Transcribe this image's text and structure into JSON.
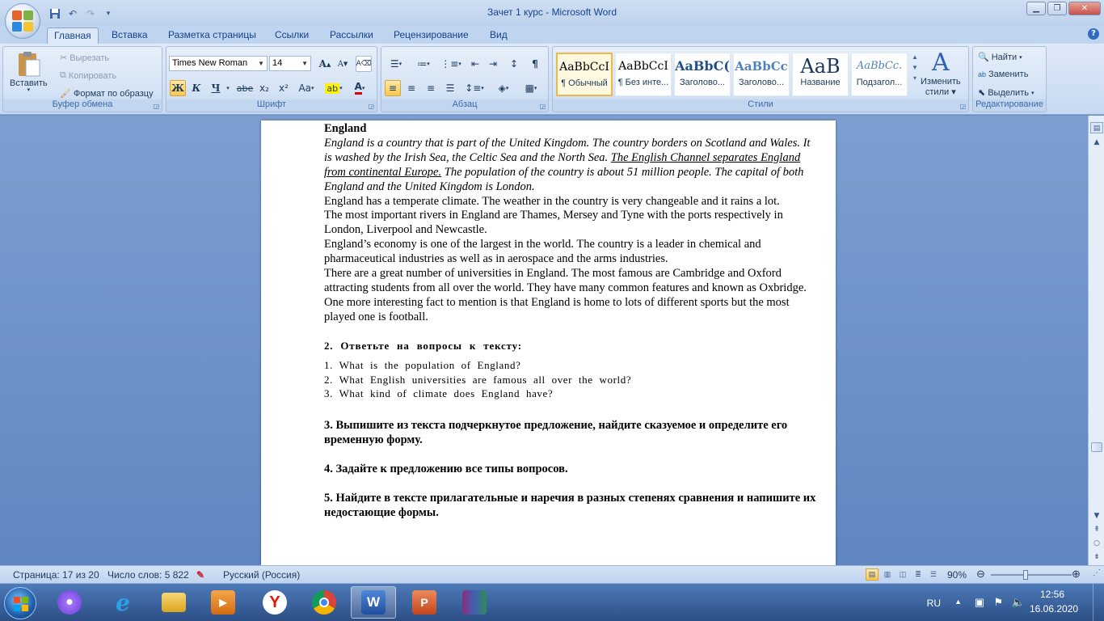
{
  "window": {
    "title": "Зачет 1 курс - Microsoft Word"
  },
  "tabs": [
    {
      "label": "Главная",
      "active": true
    },
    {
      "label": "Вставка"
    },
    {
      "label": "Разметка страницы"
    },
    {
      "label": "Ссылки"
    },
    {
      "label": "Рассылки"
    },
    {
      "label": "Рецензирование"
    },
    {
      "label": "Вид"
    }
  ],
  "ribbon": {
    "clipboard": {
      "label": "Буфер обмена",
      "paste": "Вставить",
      "cut": "Вырезать",
      "copy": "Копировать",
      "format_painter": "Формат по образцу"
    },
    "font": {
      "label": "Шрифт",
      "font_name": "Times New Roman",
      "font_size": "14",
      "bold": "Ж",
      "italic": "К",
      "underline": "Ч",
      "strike": "abe",
      "sub": "x₂",
      "sup": "x²",
      "case": "Aa",
      "grow": "A",
      "shrink": "A",
      "font_color_letter": "A"
    },
    "paragraph": {
      "label": "Абзац"
    },
    "styles": {
      "label": "Стили",
      "items": [
        {
          "sample": "AaBbCcI",
          "name": "¶ Обычный",
          "selected": true
        },
        {
          "sample": "AaBbCcI",
          "name": "¶ Без инте..."
        },
        {
          "sample": "AaBbC(",
          "name": "Заголово..."
        },
        {
          "sample": "AaBbCc",
          "name": "Заголово..."
        },
        {
          "sample": "AaB",
          "name": "Название"
        },
        {
          "sample": "AaBbCc.",
          "name": "Подзагол..."
        }
      ],
      "change_styles_line1": "Изменить",
      "change_styles_line2": "стили"
    },
    "editing": {
      "label": "Редактирование",
      "find": "Найти",
      "replace": "Заменить",
      "select": "Выделить"
    }
  },
  "document": {
    "heading": "England",
    "para1_italic_a": "England is a country that is part of the United Kingdom. The country borders on Scotland and Wales. It is washed by the Irish Sea, the Celtic Sea and the North Sea. ",
    "para1_underlined": "The English Channel separates England from continental Europe.",
    "para1_italic_b": " The population of the country is about 51 million people. The capital of both England and the United Kingdom is London.",
    "para2": "England has a temperate climate. The weather in the country is very changeable and it rains a lot.",
    "para3": "The most important rivers in England are Thames, Mersey and Tyne with the ports respectively in London, Liverpool and Newcastle.",
    "para4": "England’s economy is one of the largest in the world. The country is a leader in chemical and pharmaceutical industries as well as in aerospace and the arms industries.",
    "para5": "There are a great number of universities in England. The most famous are Cambridge and Oxford attracting students from all over the world. They have many common features and known as Oxbridge.",
    "para6": "One more interesting fact to mention is that England is home to lots of different sports but the most played one is football.",
    "task2": "2. Ответьте на вопросы к тексту:",
    "questions": [
      "1.  What is the population of England?",
      "2. What English universities are famous all over the world?",
      "3. What kind of climate does England have?"
    ],
    "task3": "3. Выпишите из текста подчеркнутое предложение, найдите сказуемое и определите его     временную форму.",
    "task4": "4. Задайте к предложению все типы вопросов.",
    "task5": "5. Найдите в тексте прилагательные и наречия в разных степенях сравнения и напишите их недостающие формы."
  },
  "status": {
    "page": "Страница: 17 из 20",
    "words": "Число слов: 5 822",
    "language": "Русский (Россия)",
    "zoom": "90%"
  },
  "taskbar": {
    "lang": "RU",
    "time": "12:56",
    "date": "16.06.2020"
  },
  "colors": {
    "ribbon_bg": "#dfeaf8",
    "doc_bg": "#6f94c9",
    "taskbar": "#2c4f86",
    "accent": "#15428b"
  }
}
